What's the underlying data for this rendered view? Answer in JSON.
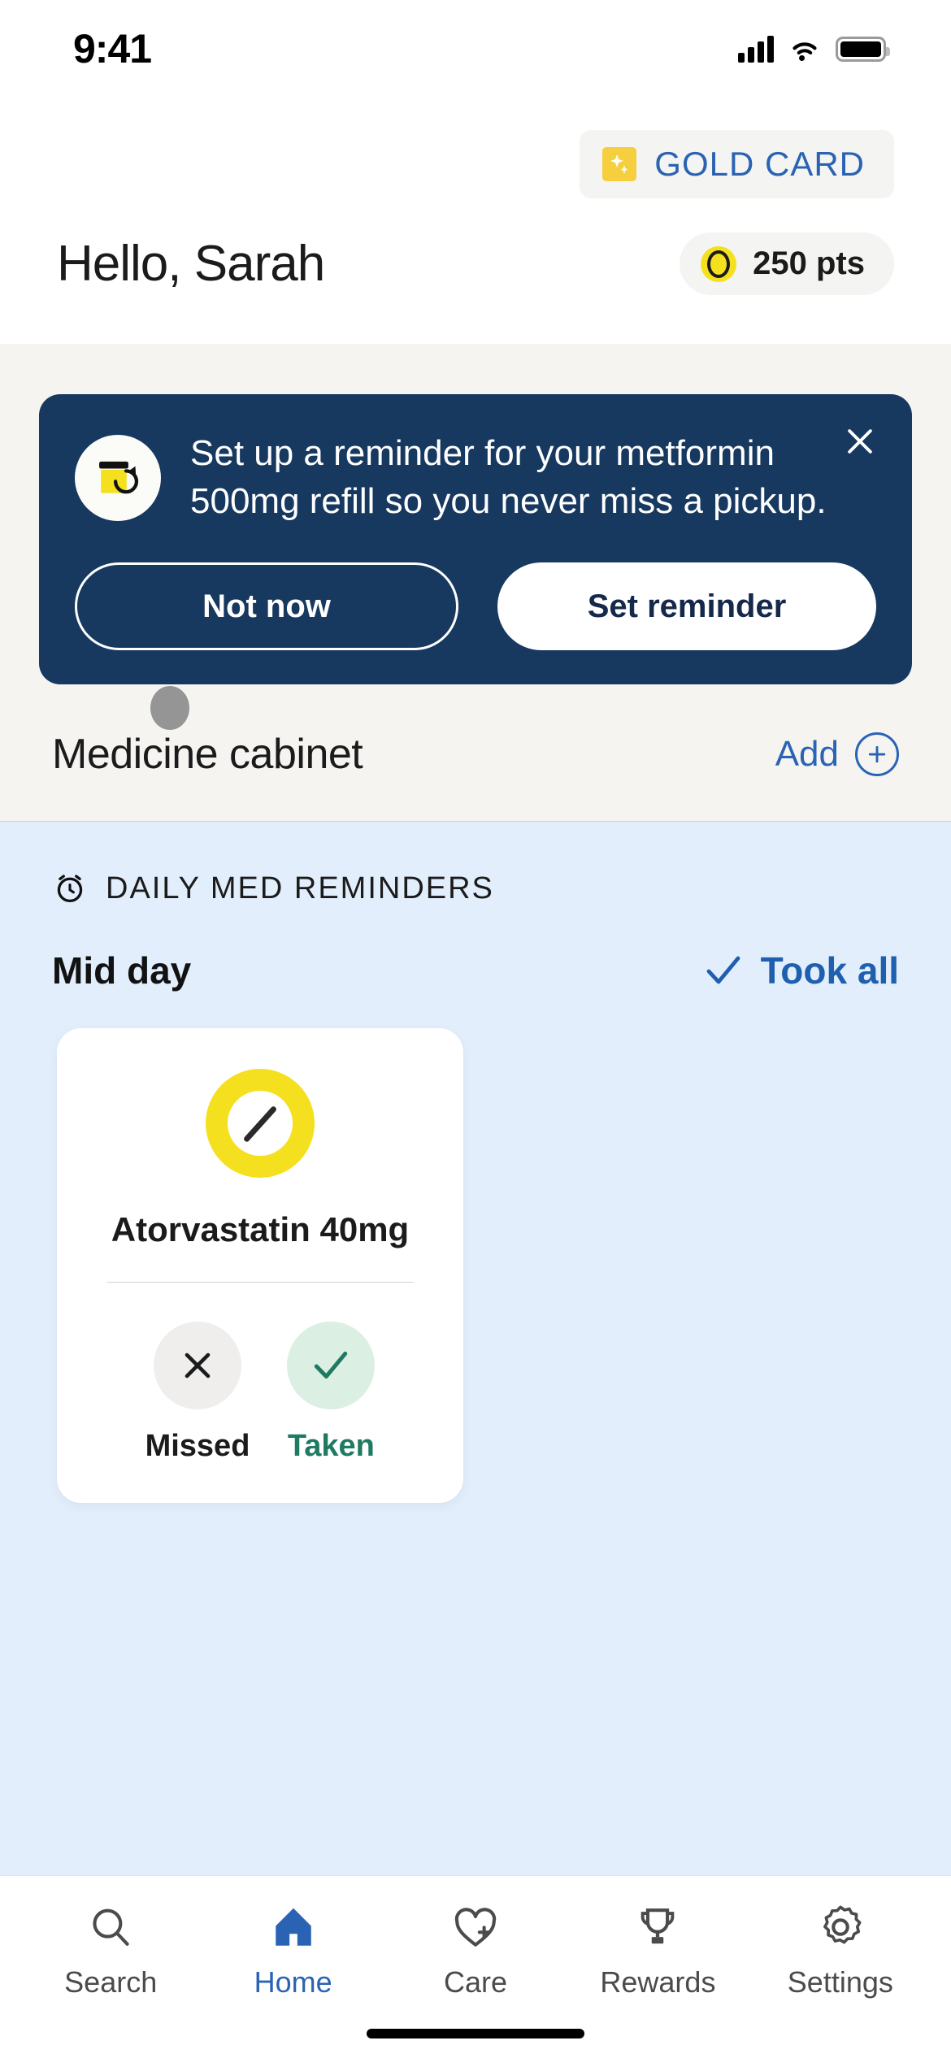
{
  "status_bar": {
    "time": "9:41",
    "signal_icon": "cellular-signal-icon",
    "wifi_icon": "wifi-icon",
    "battery_icon": "battery-icon"
  },
  "header": {
    "gold_card": {
      "label": "GOLD CARD",
      "icon": "sparkle-icon",
      "icon_bg": "#f5cf3d",
      "text_color": "#2a63b4"
    },
    "greeting": "Hello, Sarah",
    "points": {
      "value": "250 pts",
      "coin_icon": "coin-icon",
      "coin_color": "#f5e01f"
    }
  },
  "banner": {
    "icon": "pill-bottle-refill-icon",
    "message": "Set up a reminder for your metformin 500mg refill so you never miss a pickup.",
    "close_icon": "close-icon",
    "background": "#17385f",
    "secondary_button": "Not now",
    "primary_button": "Set reminder"
  },
  "medicine_cabinet": {
    "title": "Medicine cabinet",
    "add_label": "Add",
    "add_icon": "plus-circle-icon",
    "accent_color": "#2a63b4"
  },
  "reminders": {
    "section_icon": "alarm-clock-icon",
    "section_label": "DAILY MED REMINDERS",
    "background": "#e2eefb",
    "time_group": "Mid day",
    "took_all_label": "Took all",
    "took_all_icon": "check-icon",
    "cards": [
      {
        "pill_icon": "pill-capsule-icon",
        "pill_color": "#f5e01f",
        "name": "Atorvastatin 40mg",
        "missed_label": "Missed",
        "missed_icon": "close-x-icon",
        "taken_label": "Taken",
        "taken_icon": "check-icon",
        "taken_color": "#1f7a62"
      }
    ]
  },
  "tab_bar": {
    "active": "Home",
    "active_color": "#2a63b4",
    "items": [
      {
        "label": "Search",
        "icon": "search-icon"
      },
      {
        "label": "Home",
        "icon": "home-icon"
      },
      {
        "label": "Care",
        "icon": "heart-plus-icon"
      },
      {
        "label": "Rewards",
        "icon": "trophy-icon"
      },
      {
        "label": "Settings",
        "icon": "gear-icon"
      }
    ]
  }
}
